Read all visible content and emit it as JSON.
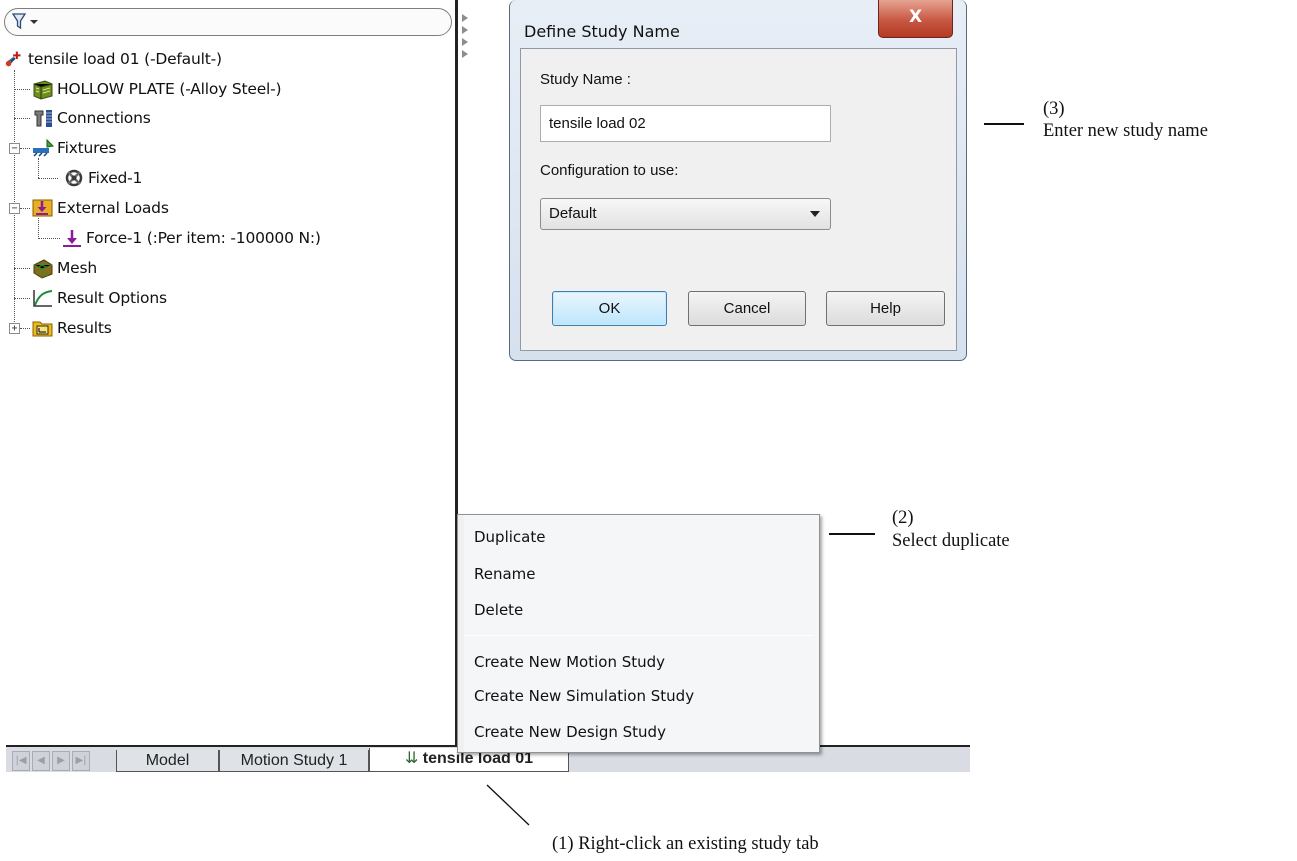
{
  "feature_tree": {
    "filter_icon": "filter-funnel-icon",
    "items": [
      {
        "label": "tensile load 01 (-Default-)",
        "icon": "study-icon"
      },
      {
        "label": "HOLLOW PLATE (-Alloy Steel-)",
        "icon": "part-icon"
      },
      {
        "label": "Connections",
        "icon": "connections-icon"
      },
      {
        "label": "Fixtures",
        "icon": "fixtures-icon"
      },
      {
        "label": "Fixed-1",
        "icon": "fixed-icon"
      },
      {
        "label": "External Loads",
        "icon": "external-loads-icon"
      },
      {
        "label": "Force-1 (:Per item: -100000 N:)",
        "icon": "force-icon"
      },
      {
        "label": "Mesh",
        "icon": "mesh-icon"
      },
      {
        "label": "Result Options",
        "icon": "result-options-icon"
      },
      {
        "label": "Results",
        "icon": "results-folder-icon"
      }
    ]
  },
  "tabs": {
    "model": "Model",
    "motion_study": "Motion Study 1",
    "active": "tensile load 01"
  },
  "context_menu": {
    "items": [
      "Duplicate",
      "Rename",
      "Delete",
      "Create New Motion Study",
      "Create New Simulation Study",
      "Create New Design Study"
    ]
  },
  "dialog": {
    "title": "Define Study Name",
    "close_label": "X",
    "study_name_label": "Study Name :",
    "study_name_value": "tensile load 02",
    "config_label": "Configuration to use:",
    "config_value": "Default",
    "ok": "OK",
    "cancel": "Cancel",
    "help": "Help"
  },
  "annotations": {
    "step1": "(1)  Right-click an existing study tab",
    "step2_num": "(2)",
    "step2_text": "Select duplicate",
    "step3_num": "(3)",
    "step3_text": "Enter new study name"
  },
  "colors": {
    "close_button": "#c75843",
    "ok_border": "#3c7fb1",
    "dialog_frame": "#d6e1ee",
    "tab_bar": "#d9dde3"
  }
}
